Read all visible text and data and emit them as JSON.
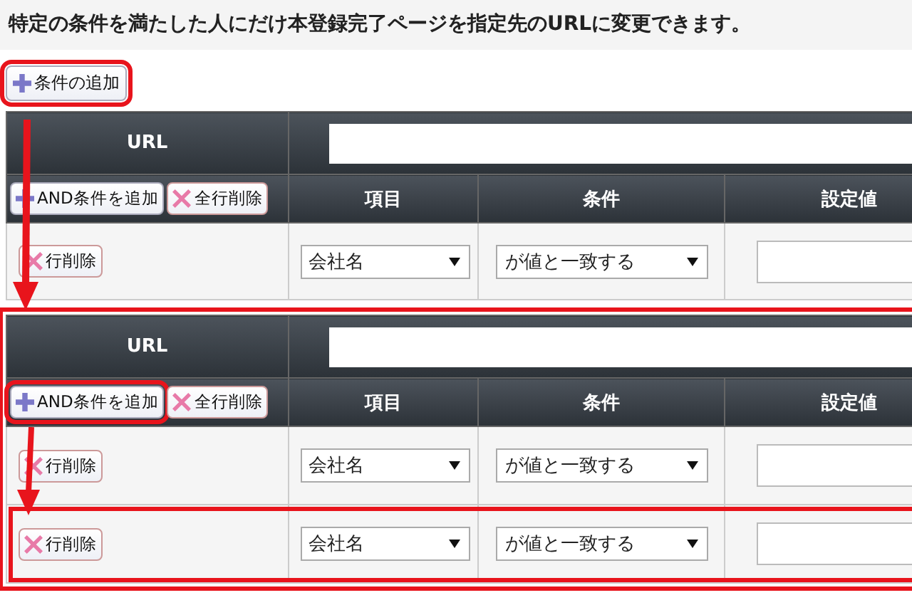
{
  "heading": "特定の条件を満たした人にだけ本登録完了ページを指定先のURLに変更できます。",
  "add_condition_button": {
    "label": "条件の追加",
    "highlighted": true
  },
  "tables": [
    {
      "highlighted": false,
      "url_label": "URL",
      "add_and_button": {
        "label": "AND条件を追加",
        "highlighted": false
      },
      "delete_all_button": "全行削除",
      "columns": [
        "項目",
        "条件",
        "設定値"
      ],
      "rows": [
        {
          "delete_button": "行削除",
          "field": "会社名",
          "condition": "が値と一致する",
          "highlighted": false
        }
      ]
    },
    {
      "highlighted": true,
      "url_label": "URL",
      "add_and_button": {
        "label": "AND条件を追加",
        "highlighted": true
      },
      "delete_all_button": "全行削除",
      "columns": [
        "項目",
        "条件",
        "設定値"
      ],
      "rows": [
        {
          "delete_button": "行削除",
          "field": "会社名",
          "condition": "が値と一致する",
          "highlighted": false
        },
        {
          "delete_button": "行削除",
          "field": "会社名",
          "condition": "が値と一致する",
          "highlighted": true
        }
      ]
    }
  ]
}
